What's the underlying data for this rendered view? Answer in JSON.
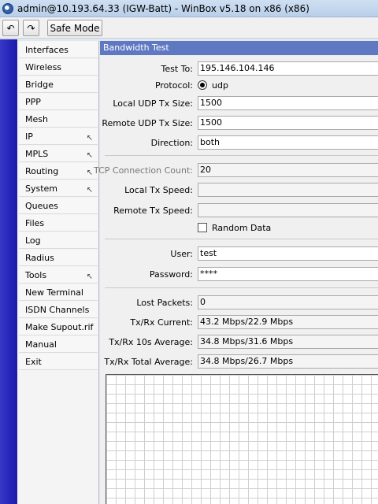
{
  "window": {
    "title": "admin@10.193.64.33 (IGW-Batt) - WinBox v5.18 on x86 (x86)"
  },
  "toolbar": {
    "undo_icon": "↶",
    "redo_icon": "↷",
    "safe_mode_label": "Safe Mode"
  },
  "menu": {
    "items": [
      {
        "label": "Interfaces",
        "submenu": false
      },
      {
        "label": "Wireless",
        "submenu": false
      },
      {
        "label": "Bridge",
        "submenu": false
      },
      {
        "label": "PPP",
        "submenu": false
      },
      {
        "label": "Mesh",
        "submenu": false
      },
      {
        "label": "IP",
        "submenu": true
      },
      {
        "label": "MPLS",
        "submenu": true
      },
      {
        "label": "Routing",
        "submenu": true
      },
      {
        "label": "System",
        "submenu": true
      },
      {
        "label": "Queues",
        "submenu": false
      },
      {
        "label": "Files",
        "submenu": false
      },
      {
        "label": "Log",
        "submenu": false
      },
      {
        "label": "Radius",
        "submenu": false
      },
      {
        "label": "Tools",
        "submenu": true
      },
      {
        "label": "New Terminal",
        "submenu": false
      },
      {
        "label": "ISDN Channels",
        "submenu": false
      },
      {
        "label": "Make Supout.rif",
        "submenu": false
      },
      {
        "label": "Manual",
        "submenu": false
      },
      {
        "label": "Exit",
        "submenu": false
      }
    ],
    "submenu_arrow": "↖"
  },
  "bandwidth_test": {
    "title": "Bandwidth Test",
    "test_to_label": "Test To:",
    "test_to_value": "195.146.104.146",
    "protocol_label": "Protocol:",
    "protocol_value": "udp",
    "local_udp_label": "Local UDP Tx Size:",
    "local_udp_value": "1500",
    "remote_udp_label": "Remote UDP Tx Size:",
    "remote_udp_value": "1500",
    "direction_label": "Direction:",
    "direction_value": "both",
    "tcp_count_label": "TCP Connection Count:",
    "tcp_count_value": "20",
    "local_tx_speed_label": "Local Tx Speed:",
    "local_tx_speed_value": "",
    "remote_tx_speed_label": "Remote Tx Speed:",
    "remote_tx_speed_value": "",
    "random_data_label": "Random Data",
    "random_data_checked": false,
    "user_label": "User:",
    "user_value": "test",
    "password_label": "Password:",
    "password_value": "****",
    "lost_packets_label": "Lost Packets:",
    "lost_packets_value": "0",
    "current_label": "Tx/Rx Current:",
    "current_value": "43.2 Mbps/22.9 Mbps",
    "avg10_label": "Tx/Rx 10s Average:",
    "avg10_value": "34.8 Mbps/31.6 Mbps",
    "total_avg_label": "Tx/Rx Total Average:",
    "total_avg_value": "34.8 Mbps/26.7 Mbps"
  }
}
